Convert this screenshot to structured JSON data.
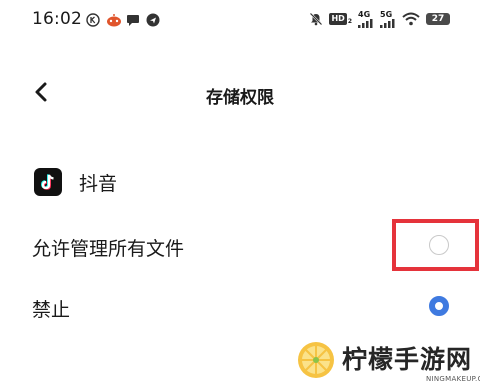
{
  "status_bar": {
    "time": "16:02",
    "network_1": "4G",
    "network_2": "5G",
    "hd_label": "HD",
    "battery": "27",
    "left_icons": [
      "k-circle-icon",
      "app-notification-icon",
      "chat-bubble-icon",
      "location-icon"
    ],
    "right_icons": [
      "mute-icon",
      "hd-icon",
      "signal-icon",
      "signal-icon",
      "wifi-icon",
      "battery-icon"
    ]
  },
  "header": {
    "title": "存储权限",
    "back_icon": "chevron-left-icon"
  },
  "app": {
    "name": "抖音",
    "icon": "tiktok-icon"
  },
  "options": [
    {
      "label": "允许管理所有文件",
      "selected": false
    },
    {
      "label": "禁止",
      "selected": true
    }
  ],
  "colors": {
    "accent": "#3f7ae0",
    "highlight": "#e5333b",
    "radio_off": "#c9c9c9"
  },
  "watermark": {
    "text": "柠檬手游网",
    "url": "NINGMAKEUP.COM"
  }
}
